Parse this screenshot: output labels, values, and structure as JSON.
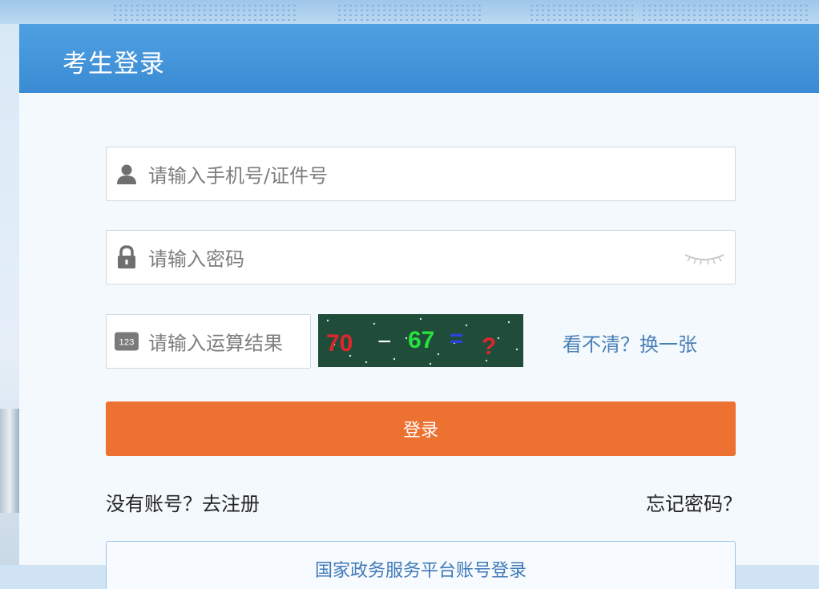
{
  "panel": {
    "title": "考生登录"
  },
  "form": {
    "username_placeholder": "请输入手机号/证件号",
    "password_placeholder": "请输入密码",
    "captcha_placeholder": "请输入运算结果",
    "captcha_icon_text": "123",
    "captcha_expression": [
      "70",
      "−",
      "67",
      "=",
      "?"
    ],
    "captcha_colors": [
      "#e0262b",
      "#ffffff",
      "#27e03c",
      "#2c43e0",
      "#e0262b"
    ],
    "refresh_link": "看不清？换一张",
    "login_button": "登录"
  },
  "links": {
    "register": "没有账号？去注册",
    "forgot_password": "忘记密码？"
  },
  "alt_login": {
    "label": "国家政务服务平台账号登录"
  },
  "colors": {
    "header": "#3a8bd3",
    "login_button": "#ed7130",
    "link": "#4a7fb7"
  }
}
